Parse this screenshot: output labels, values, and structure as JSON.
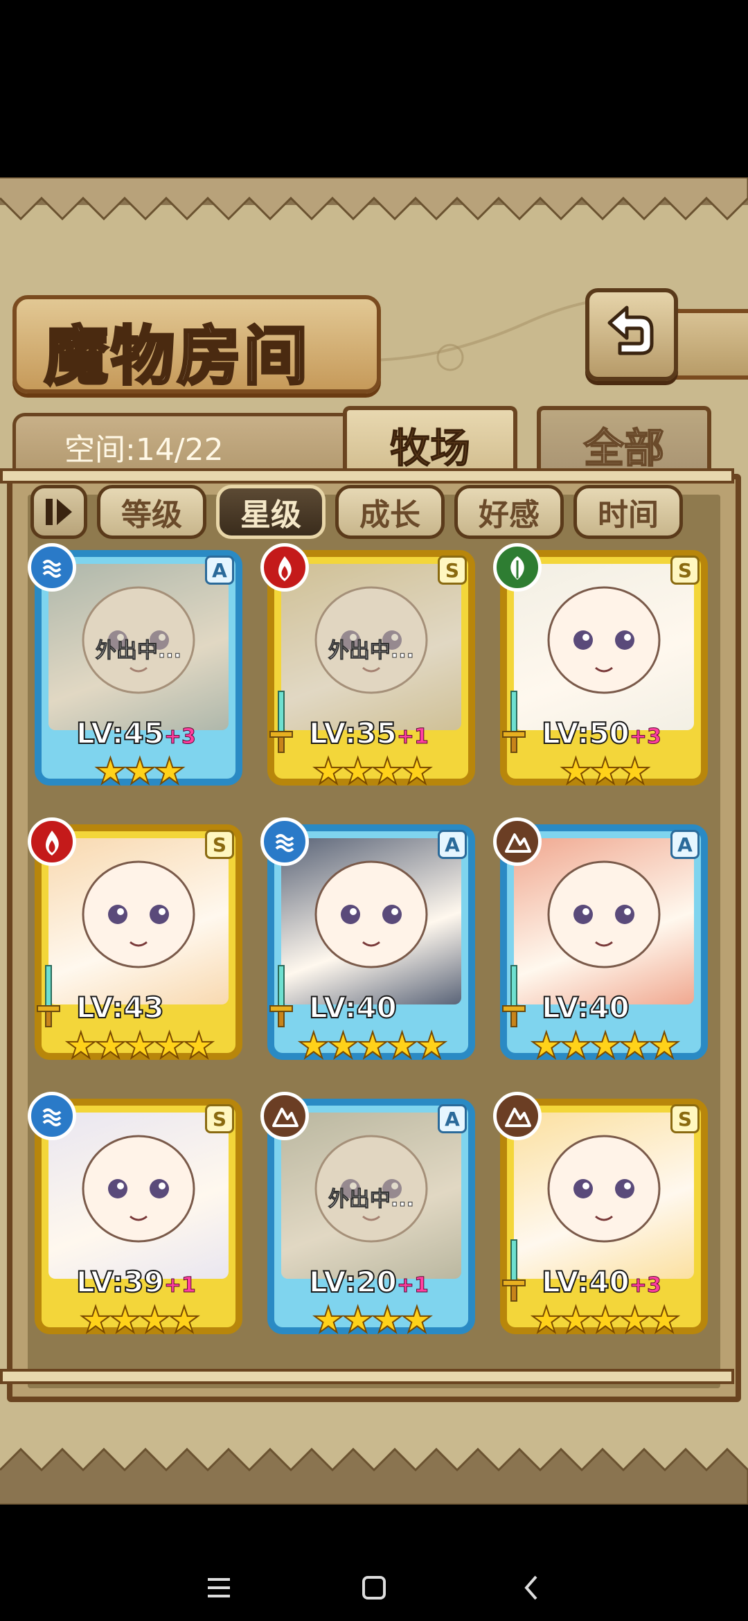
{
  "title": "魔物房间",
  "space": "空间:14/22",
  "tabs": [
    {
      "label": "牧场",
      "active": true
    },
    {
      "label": "全部",
      "active": false
    }
  ],
  "filters": [
    {
      "label": "等级",
      "active": false
    },
    {
      "label": "星级",
      "active": true
    },
    {
      "label": "成长",
      "active": false
    },
    {
      "label": "好感",
      "active": false
    },
    {
      "label": "时间",
      "active": false
    }
  ],
  "monsters": [
    {
      "element": "water",
      "rank": "A",
      "frame": "blue",
      "level": "LV:45",
      "bonus": "+3",
      "stars": "★★★",
      "star_count": 3,
      "away": "外出中...",
      "sword": false,
      "tint": "#8fb0b8"
    },
    {
      "element": "fire",
      "rank": "S",
      "frame": "gold",
      "level": "LV:35",
      "bonus": "+1",
      "stars": "★★★★",
      "star_count": 4,
      "away": "外出中...",
      "sword": true,
      "tint": "#d8c48a"
    },
    {
      "element": "grass",
      "rank": "S",
      "frame": "gold",
      "level": "LV:50",
      "bonus": "+3",
      "stars": "★★★",
      "star_count": 3,
      "away": "",
      "sword": true,
      "tint": "#f2efe4"
    },
    {
      "element": "fire",
      "rank": "S",
      "frame": "gold",
      "level": "LV:43",
      "bonus": "",
      "stars": "★★★★★",
      "star_count": 5,
      "away": "",
      "sword": true,
      "tint": "#f8d9b0"
    },
    {
      "element": "water",
      "rank": "A",
      "frame": "blue",
      "level": "LV:40",
      "bonus": "",
      "stars": "★★★★★",
      "star_count": 5,
      "away": "",
      "sword": true,
      "tint": "#5a6478"
    },
    {
      "element": "earth",
      "rank": "A",
      "frame": "blue",
      "level": "LV:40",
      "bonus": "",
      "stars": "★★★★★",
      "star_count": 5,
      "away": "",
      "sword": true,
      "tint": "#f0a890"
    },
    {
      "element": "water",
      "rank": "S",
      "frame": "gold",
      "level": "LV:39",
      "bonus": "+1",
      "stars": "★★★★",
      "star_count": 4,
      "away": "",
      "sword": false,
      "tint": "#e9e6f0"
    },
    {
      "element": "earth",
      "rank": "A",
      "frame": "blue",
      "level": "LV:20",
      "bonus": "+1",
      "stars": "★★★★",
      "star_count": 4,
      "away": "外出中...",
      "sword": false,
      "tint": "#a9b0a0"
    },
    {
      "element": "earth",
      "rank": "S",
      "frame": "gold",
      "level": "LV:40",
      "bonus": "+3",
      "stars": "★★★★★",
      "star_count": 5,
      "away": "",
      "sword": true,
      "tint": "#fbe0a0"
    }
  ],
  "colors": {
    "water": "#2a7ac8",
    "fire": "#c41a1a",
    "grass": "#2e7d32",
    "earth": "#6b3e24",
    "frame_blue": "#7fd4ee",
    "frame_gold": "#f3d63a",
    "star": "#ffd21a"
  },
  "icons": {
    "back": "return-arrow-icon",
    "filter_toggle": "filter-toggle-icon",
    "nav": [
      "menu-icon",
      "home-square-icon",
      "back-chevron-icon"
    ]
  }
}
